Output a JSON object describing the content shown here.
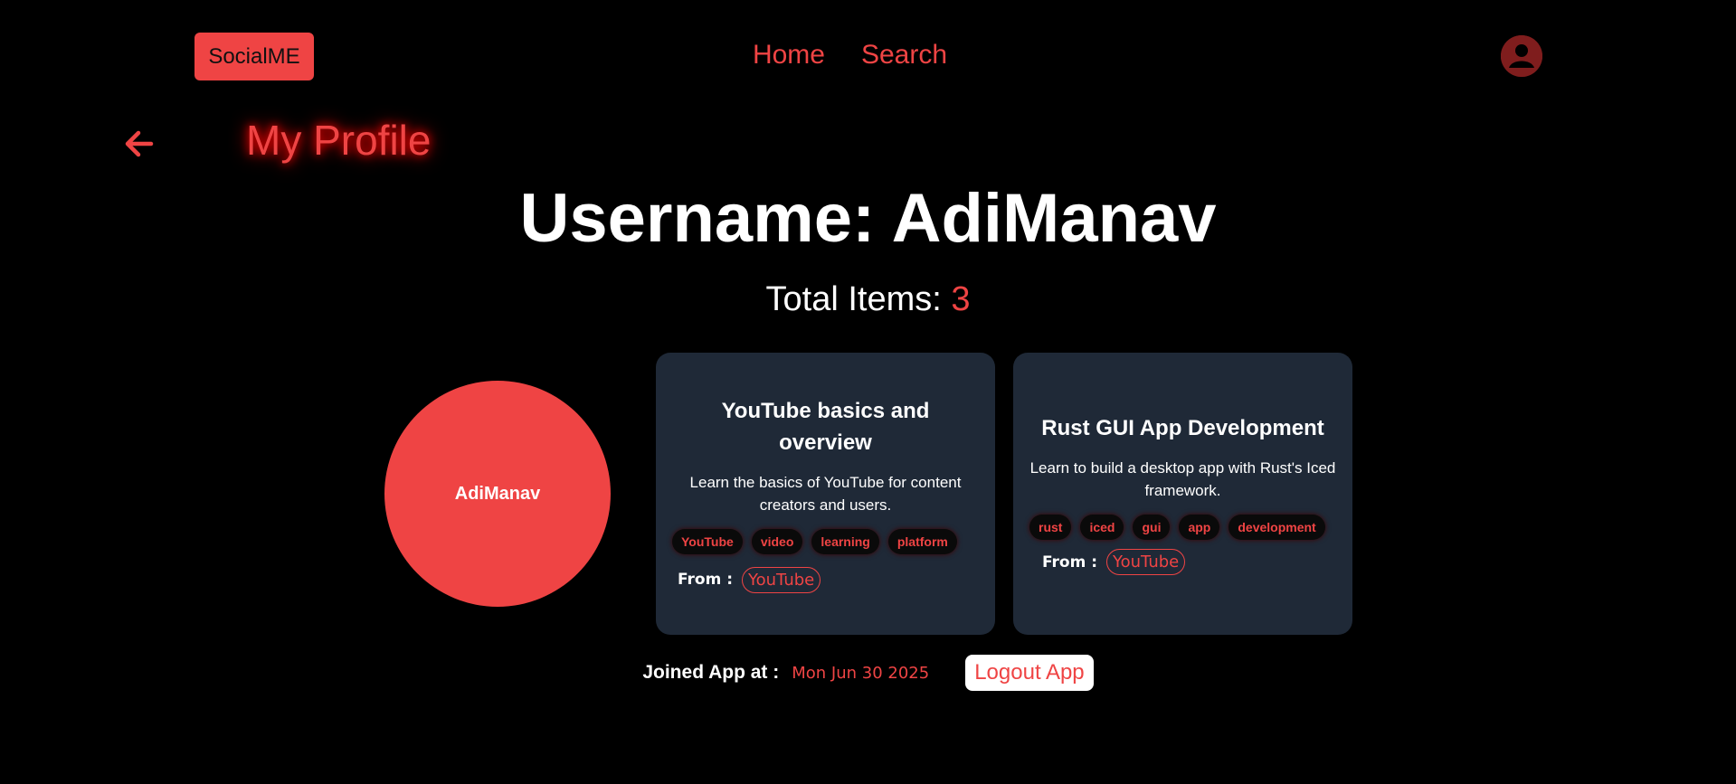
{
  "header": {
    "brand": "SocialME",
    "nav": [
      {
        "label": "Home"
      },
      {
        "label": "Search"
      }
    ],
    "avatar_icon": "user-circle-icon"
  },
  "page": {
    "back_icon": "arrow-left-icon",
    "title": "My Profile",
    "username_heading": "Username: AdiManav",
    "total_label": "Total Items: ",
    "total_value": "3",
    "avatar_text": "AdiManav"
  },
  "items": [
    {
      "title": "YouTube basics and overview",
      "description": "Learn the basics of YouTube for content creators and users.",
      "tags": [
        "YouTube",
        "video",
        "learning",
        "platform"
      ],
      "from_label": "From :",
      "source": "YouTube"
    },
    {
      "title": "Rust GUI App Development",
      "description": "Learn to build a desktop app with Rust's Iced framework.",
      "tags": [
        "rust",
        "iced",
        "gui",
        "app",
        "development"
      ],
      "from_label": "From :",
      "source": "YouTube"
    }
  ],
  "footer": {
    "joined_label": "Joined App at :",
    "joined_date": "Mon Jun 30 2025",
    "logout_label": "Logout App"
  },
  "colors": {
    "accent": "#ef4444",
    "card_bg": "#1f2937",
    "background": "#000000"
  }
}
